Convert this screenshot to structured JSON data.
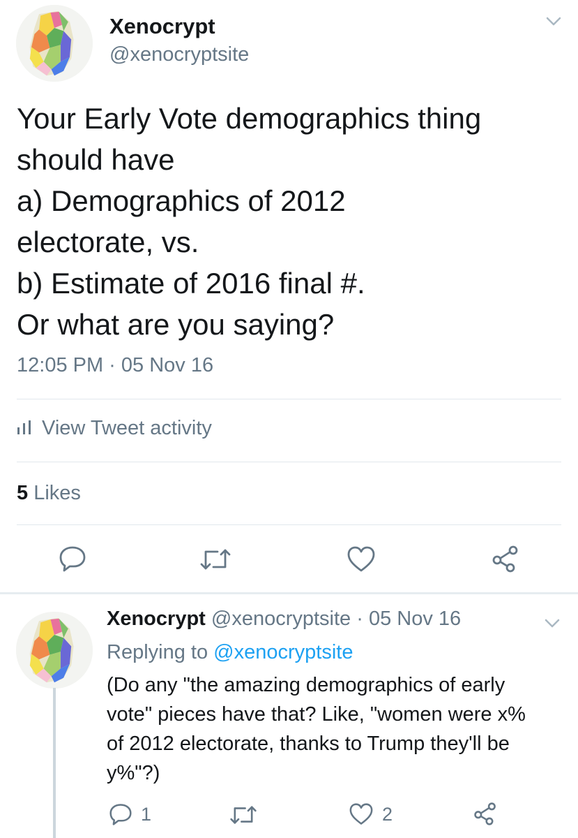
{
  "tweet": {
    "author_name": "Xenocrypt",
    "author_handle": "@xenocryptsite",
    "text": "Your Early Vote demographics thing\nshould have\na) Demographics of 2012\nelectorate, vs.\nb) Estimate of 2016 final #.\nOr what are you saying?",
    "timestamp": "12:05 PM · 05 Nov 16",
    "activity_label": "View Tweet activity",
    "likes_count": "5",
    "likes_label": "Likes",
    "icons": {
      "reply": "reply-icon",
      "retweet": "retweet-icon",
      "like": "heart-icon",
      "share": "share-icon",
      "activity": "bar-chart-icon",
      "menu": "chevron-down-icon"
    }
  },
  "reply": {
    "author_name": "Xenocrypt",
    "author_handle": "@xenocryptsite",
    "separator": "·",
    "date": "05 Nov 16",
    "replying_prefix": "Replying to",
    "replying_to": "@xenocryptsite",
    "text": "(Do any \"the amazing demographics of early\nvote\" pieces have that? Like, \"women were x%\nof 2012 electorate, thanks to Trump they'll be\ny%\"?)",
    "reply_count": "1",
    "like_count": "2"
  },
  "colors": {
    "link": "#1da1f2",
    "secondary_text": "#657786",
    "divider": "#e1e8ed"
  }
}
